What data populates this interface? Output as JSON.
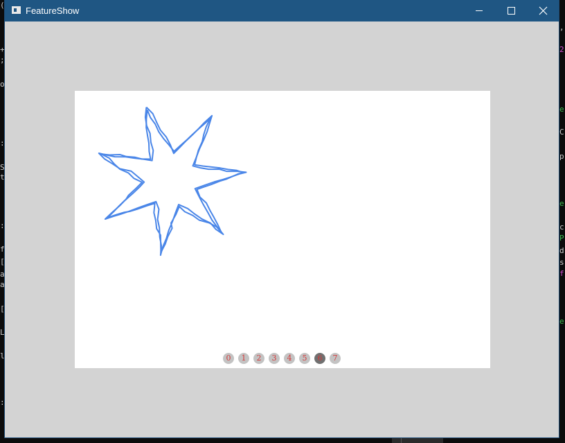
{
  "window": {
    "title": "FeatureShow",
    "controls": {
      "minimize": "minimize",
      "maximize": "maximize",
      "close": "close"
    }
  },
  "canvas": {
    "background": "#ffffff",
    "stroke_color": "#4a86e8",
    "star_points": 7
  },
  "pager": {
    "pages": [
      "0",
      "1",
      "2",
      "3",
      "4",
      "5",
      "6",
      "7"
    ],
    "active_index": 6
  }
}
